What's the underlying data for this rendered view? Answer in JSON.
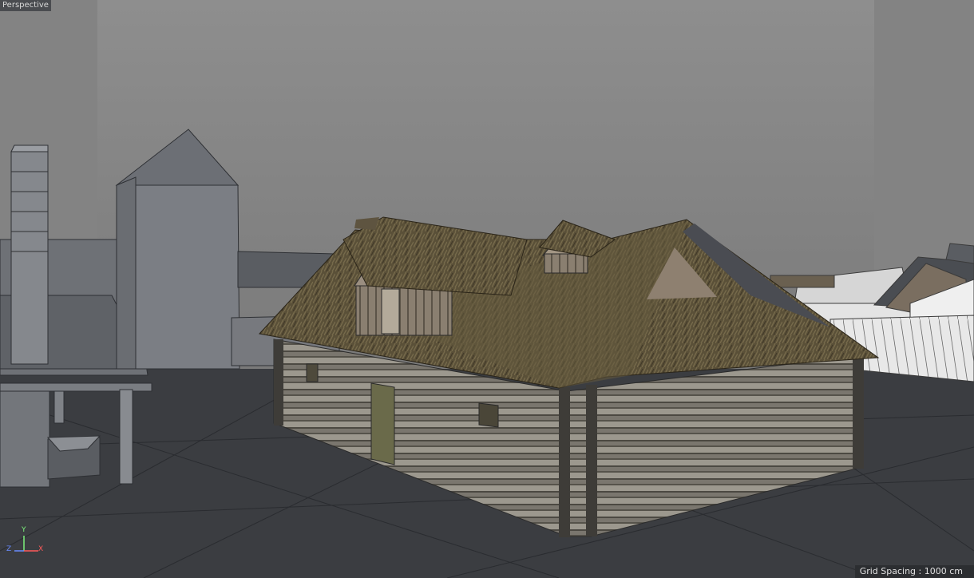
{
  "viewport": {
    "camera_label": "Perspective",
    "grid_spacing": "Grid Spacing : 1000 cm"
  },
  "axis_gizmo": {
    "x_label": "X",
    "y_label": "Y",
    "z_label": "Z"
  },
  "colors": {
    "sky": "#8a8a8a",
    "ground": "#3a3c40",
    "grey_geometry": "#7c7f84",
    "white_geometry": "#e6e6e6",
    "thatch": "#5c5238",
    "logs": "#8e8a80",
    "axis_x": "#ff5a5a",
    "axis_y": "#7cf27c",
    "axis_z": "#6a8cff"
  },
  "icons": {
    "axis_gizmo": "axis-gizmo-icon"
  }
}
